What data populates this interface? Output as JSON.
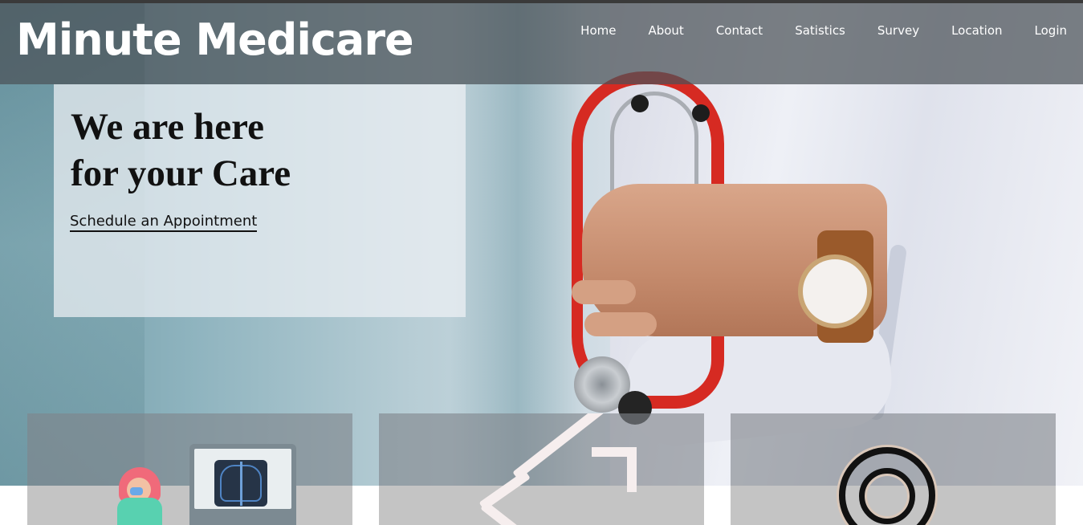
{
  "brand": {
    "name": "Minute Medicare"
  },
  "nav": {
    "items": [
      {
        "label": "Home"
      },
      {
        "label": "About"
      },
      {
        "label": "Contact"
      },
      {
        "label": "Satistics"
      },
      {
        "label": "Survey"
      },
      {
        "label": "Location"
      },
      {
        "label": "Login"
      }
    ]
  },
  "hero": {
    "title_line1": "We are here",
    "title_line2": "for your Care",
    "cta_label": "Schedule an Appointment"
  },
  "feature_cards": [
    {
      "icon": "xray-nurse-icon"
    },
    {
      "icon": "growth-arrow-icon"
    },
    {
      "icon": "target-icon"
    }
  ],
  "colors": {
    "navbar_overlay": "#4b5258",
    "stethoscope_red": "#d62a22",
    "text_dark": "#111111",
    "nav_text": "#ffffff"
  }
}
